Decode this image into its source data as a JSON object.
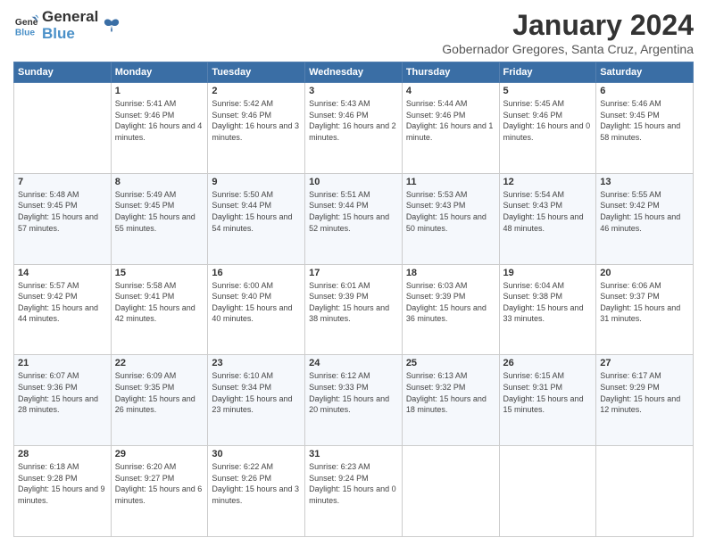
{
  "logo": {
    "line1": "General",
    "line2": "Blue"
  },
  "title": "January 2024",
  "subtitle": "Gobernador Gregores, Santa Cruz, Argentina",
  "weekdays": [
    "Sunday",
    "Monday",
    "Tuesday",
    "Wednesday",
    "Thursday",
    "Friday",
    "Saturday"
  ],
  "weeks": [
    [
      {
        "day": "",
        "sunrise": "",
        "sunset": "",
        "daylight": ""
      },
      {
        "day": "1",
        "sunrise": "Sunrise: 5:41 AM",
        "sunset": "Sunset: 9:46 PM",
        "daylight": "Daylight: 16 hours and 4 minutes."
      },
      {
        "day": "2",
        "sunrise": "Sunrise: 5:42 AM",
        "sunset": "Sunset: 9:46 PM",
        "daylight": "Daylight: 16 hours and 3 minutes."
      },
      {
        "day": "3",
        "sunrise": "Sunrise: 5:43 AM",
        "sunset": "Sunset: 9:46 PM",
        "daylight": "Daylight: 16 hours and 2 minutes."
      },
      {
        "day": "4",
        "sunrise": "Sunrise: 5:44 AM",
        "sunset": "Sunset: 9:46 PM",
        "daylight": "Daylight: 16 hours and 1 minute."
      },
      {
        "day": "5",
        "sunrise": "Sunrise: 5:45 AM",
        "sunset": "Sunset: 9:46 PM",
        "daylight": "Daylight: 16 hours and 0 minutes."
      },
      {
        "day": "6",
        "sunrise": "Sunrise: 5:46 AM",
        "sunset": "Sunset: 9:45 PM",
        "daylight": "Daylight: 15 hours and 58 minutes."
      }
    ],
    [
      {
        "day": "7",
        "sunrise": "Sunrise: 5:48 AM",
        "sunset": "Sunset: 9:45 PM",
        "daylight": "Daylight: 15 hours and 57 minutes."
      },
      {
        "day": "8",
        "sunrise": "Sunrise: 5:49 AM",
        "sunset": "Sunset: 9:45 PM",
        "daylight": "Daylight: 15 hours and 55 minutes."
      },
      {
        "day": "9",
        "sunrise": "Sunrise: 5:50 AM",
        "sunset": "Sunset: 9:44 PM",
        "daylight": "Daylight: 15 hours and 54 minutes."
      },
      {
        "day": "10",
        "sunrise": "Sunrise: 5:51 AM",
        "sunset": "Sunset: 9:44 PM",
        "daylight": "Daylight: 15 hours and 52 minutes."
      },
      {
        "day": "11",
        "sunrise": "Sunrise: 5:53 AM",
        "sunset": "Sunset: 9:43 PM",
        "daylight": "Daylight: 15 hours and 50 minutes."
      },
      {
        "day": "12",
        "sunrise": "Sunrise: 5:54 AM",
        "sunset": "Sunset: 9:43 PM",
        "daylight": "Daylight: 15 hours and 48 minutes."
      },
      {
        "day": "13",
        "sunrise": "Sunrise: 5:55 AM",
        "sunset": "Sunset: 9:42 PM",
        "daylight": "Daylight: 15 hours and 46 minutes."
      }
    ],
    [
      {
        "day": "14",
        "sunrise": "Sunrise: 5:57 AM",
        "sunset": "Sunset: 9:42 PM",
        "daylight": "Daylight: 15 hours and 44 minutes."
      },
      {
        "day": "15",
        "sunrise": "Sunrise: 5:58 AM",
        "sunset": "Sunset: 9:41 PM",
        "daylight": "Daylight: 15 hours and 42 minutes."
      },
      {
        "day": "16",
        "sunrise": "Sunrise: 6:00 AM",
        "sunset": "Sunset: 9:40 PM",
        "daylight": "Daylight: 15 hours and 40 minutes."
      },
      {
        "day": "17",
        "sunrise": "Sunrise: 6:01 AM",
        "sunset": "Sunset: 9:39 PM",
        "daylight": "Daylight: 15 hours and 38 minutes."
      },
      {
        "day": "18",
        "sunrise": "Sunrise: 6:03 AM",
        "sunset": "Sunset: 9:39 PM",
        "daylight": "Daylight: 15 hours and 36 minutes."
      },
      {
        "day": "19",
        "sunrise": "Sunrise: 6:04 AM",
        "sunset": "Sunset: 9:38 PM",
        "daylight": "Daylight: 15 hours and 33 minutes."
      },
      {
        "day": "20",
        "sunrise": "Sunrise: 6:06 AM",
        "sunset": "Sunset: 9:37 PM",
        "daylight": "Daylight: 15 hours and 31 minutes."
      }
    ],
    [
      {
        "day": "21",
        "sunrise": "Sunrise: 6:07 AM",
        "sunset": "Sunset: 9:36 PM",
        "daylight": "Daylight: 15 hours and 28 minutes."
      },
      {
        "day": "22",
        "sunrise": "Sunrise: 6:09 AM",
        "sunset": "Sunset: 9:35 PM",
        "daylight": "Daylight: 15 hours and 26 minutes."
      },
      {
        "day": "23",
        "sunrise": "Sunrise: 6:10 AM",
        "sunset": "Sunset: 9:34 PM",
        "daylight": "Daylight: 15 hours and 23 minutes."
      },
      {
        "day": "24",
        "sunrise": "Sunrise: 6:12 AM",
        "sunset": "Sunset: 9:33 PM",
        "daylight": "Daylight: 15 hours and 20 minutes."
      },
      {
        "day": "25",
        "sunrise": "Sunrise: 6:13 AM",
        "sunset": "Sunset: 9:32 PM",
        "daylight": "Daylight: 15 hours and 18 minutes."
      },
      {
        "day": "26",
        "sunrise": "Sunrise: 6:15 AM",
        "sunset": "Sunset: 9:31 PM",
        "daylight": "Daylight: 15 hours and 15 minutes."
      },
      {
        "day": "27",
        "sunrise": "Sunrise: 6:17 AM",
        "sunset": "Sunset: 9:29 PM",
        "daylight": "Daylight: 15 hours and 12 minutes."
      }
    ],
    [
      {
        "day": "28",
        "sunrise": "Sunrise: 6:18 AM",
        "sunset": "Sunset: 9:28 PM",
        "daylight": "Daylight: 15 hours and 9 minutes."
      },
      {
        "day": "29",
        "sunrise": "Sunrise: 6:20 AM",
        "sunset": "Sunset: 9:27 PM",
        "daylight": "Daylight: 15 hours and 6 minutes."
      },
      {
        "day": "30",
        "sunrise": "Sunrise: 6:22 AM",
        "sunset": "Sunset: 9:26 PM",
        "daylight": "Daylight: 15 hours and 3 minutes."
      },
      {
        "day": "31",
        "sunrise": "Sunrise: 6:23 AM",
        "sunset": "Sunset: 9:24 PM",
        "daylight": "Daylight: 15 hours and 0 minutes."
      },
      {
        "day": "",
        "sunrise": "",
        "sunset": "",
        "daylight": ""
      },
      {
        "day": "",
        "sunrise": "",
        "sunset": "",
        "daylight": ""
      },
      {
        "day": "",
        "sunrise": "",
        "sunset": "",
        "daylight": ""
      }
    ]
  ]
}
